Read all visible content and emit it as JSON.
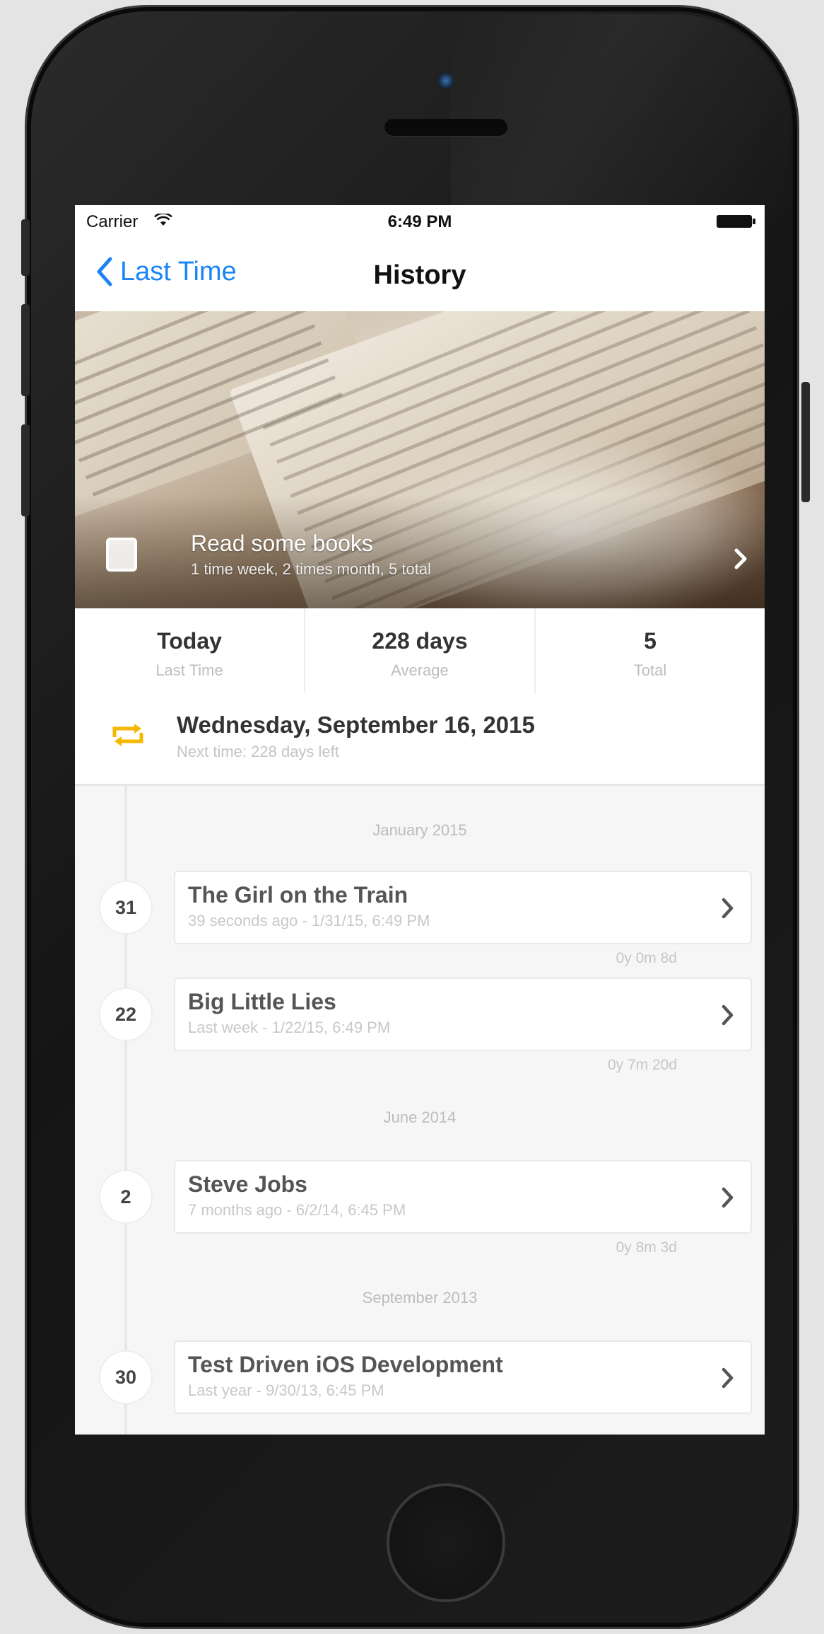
{
  "status_bar": {
    "carrier": "Carrier",
    "time": "6:49 PM"
  },
  "nav": {
    "back_label": "Last Time",
    "title": "History"
  },
  "hero": {
    "title": "Read some books",
    "subtitle": "1 time week, 2 times month, 5 total"
  },
  "stats": [
    {
      "value": "Today",
      "label": "Last Time"
    },
    {
      "value": "228 days",
      "label": "Average"
    },
    {
      "value": "5",
      "label": "Total"
    }
  ],
  "next": {
    "date": "Wednesday, September 16, 2015",
    "sub": "Next time: 228 days left"
  },
  "history": {
    "sections": [
      "January 2015",
      "June 2014",
      "September 2013"
    ],
    "entries": [
      {
        "day": "31",
        "title": "The Girl on the Train",
        "sub": "39 seconds ago - 1/31/15, 6:49 PM",
        "gap": "0y 0m 8d"
      },
      {
        "day": "22",
        "title": "Big Little Lies",
        "sub": "Last week - 1/22/15, 6:49 PM",
        "gap": "0y 7m 20d"
      },
      {
        "day": "2",
        "title": "Steve Jobs",
        "sub": "7 months ago - 6/2/14, 6:45 PM",
        "gap": "0y 8m 3d"
      },
      {
        "day": "30",
        "title": "Test Driven iOS Development",
        "sub": "Last year - 9/30/13, 6:45 PM",
        "gap": ""
      }
    ]
  },
  "colors": {
    "accent": "#1a84f5",
    "repeat_icon": "#f5b800"
  },
  "icons": [
    "wifi-icon",
    "battery-icon",
    "back-chevron-icon",
    "checkbox-icon",
    "chevron-right-icon",
    "repeat-icon"
  ]
}
